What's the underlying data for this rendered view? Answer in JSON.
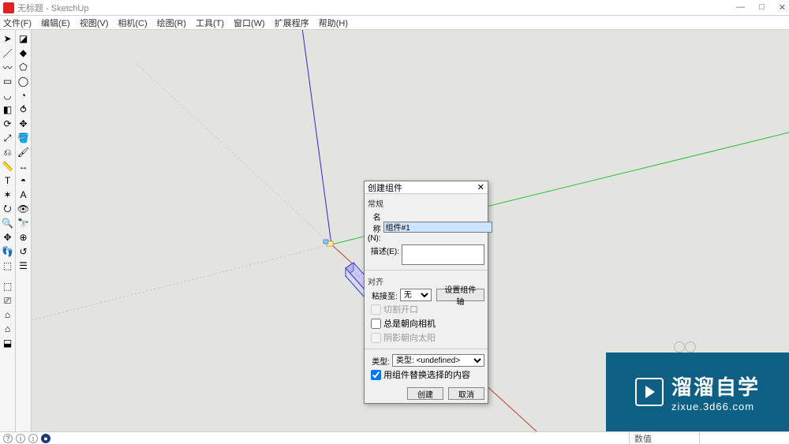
{
  "window": {
    "title": "无标题 - SketchUp",
    "buttons": {
      "min": "—",
      "max": "□",
      "close": "✕"
    }
  },
  "menu": [
    "文件(F)",
    "编辑(E)",
    "视图(V)",
    "相机(C)",
    "绘图(R)",
    "工具(T)",
    "窗口(W)",
    "扩展程序",
    "帮助(H)"
  ],
  "tools_col1": [
    {
      "name": "select",
      "glyph": "➤"
    },
    {
      "name": "line",
      "glyph": "／"
    },
    {
      "name": "freehand",
      "glyph": "〰"
    },
    {
      "name": "rectangle",
      "glyph": "▭"
    },
    {
      "name": "arc",
      "glyph": "◡"
    },
    {
      "name": "pushpull",
      "glyph": "◧"
    },
    {
      "name": "rotate",
      "glyph": "⟳"
    },
    {
      "name": "scale",
      "glyph": "⤢"
    },
    {
      "name": "offset",
      "glyph": "⎌"
    },
    {
      "name": "tape",
      "glyph": "📏"
    },
    {
      "name": "text",
      "glyph": "T"
    },
    {
      "name": "axes",
      "glyph": "✶"
    },
    {
      "name": "orbit",
      "glyph": "⭮"
    },
    {
      "name": "zoom",
      "glyph": "🔍"
    },
    {
      "name": "pan",
      "glyph": "✥"
    },
    {
      "name": "walk",
      "glyph": "👣"
    },
    {
      "name": "section",
      "glyph": "⬚"
    },
    {
      "name": "icon-a",
      "glyph": "⬚"
    },
    {
      "name": "icon-b",
      "glyph": "⎚"
    },
    {
      "name": "icon-c",
      "glyph": "⌂"
    },
    {
      "name": "icon-d",
      "glyph": "⌂"
    },
    {
      "name": "icon-e",
      "glyph": "⬓"
    }
  ],
  "tools_col2": [
    {
      "name": "eraser",
      "glyph": "◪"
    },
    {
      "name": "shape",
      "glyph": "◆"
    },
    {
      "name": "polygon",
      "glyph": "⬠"
    },
    {
      "name": "circle",
      "glyph": "◯"
    },
    {
      "name": "pie",
      "glyph": "◔"
    },
    {
      "name": "follow",
      "glyph": "⥀"
    },
    {
      "name": "move",
      "glyph": "✥"
    },
    {
      "name": "color",
      "glyph": "🪣"
    },
    {
      "name": "paint",
      "glyph": "🖌"
    },
    {
      "name": "dim",
      "glyph": "↔"
    },
    {
      "name": "protractor",
      "glyph": "◓"
    },
    {
      "name": "3dtext",
      "glyph": "A"
    },
    {
      "name": "look",
      "glyph": "👁"
    },
    {
      "name": "zoomext",
      "glyph": "🔭"
    },
    {
      "name": "position",
      "glyph": "⊕"
    },
    {
      "name": "prev",
      "glyph": "↺"
    },
    {
      "name": "layers",
      "glyph": "☰"
    }
  ],
  "dialog": {
    "title": "创建组件",
    "section_general": "常规",
    "name_label": "名称(N):",
    "name_value": "组件#1",
    "desc_label": "描述(E):",
    "desc_value": "",
    "section_align": "对齐",
    "glue_label": "粘接至:",
    "glue_value": "无",
    "set_axes_btn": "设置组件轴",
    "chk_cut": "切割开口",
    "chk_face_camera": "总是朝向相机",
    "chk_shadow": "阴影朝向太阳",
    "type_label": "类型:",
    "type_value": "类型: <undefined>",
    "chk_replace": "用组件替换选择的内容",
    "btn_create": "创建",
    "btn_cancel": "取消"
  },
  "watermark": {
    "big": "溜溜自学",
    "small": "zixue.3d66.com"
  },
  "statusbar": {
    "value_label": "数值"
  }
}
